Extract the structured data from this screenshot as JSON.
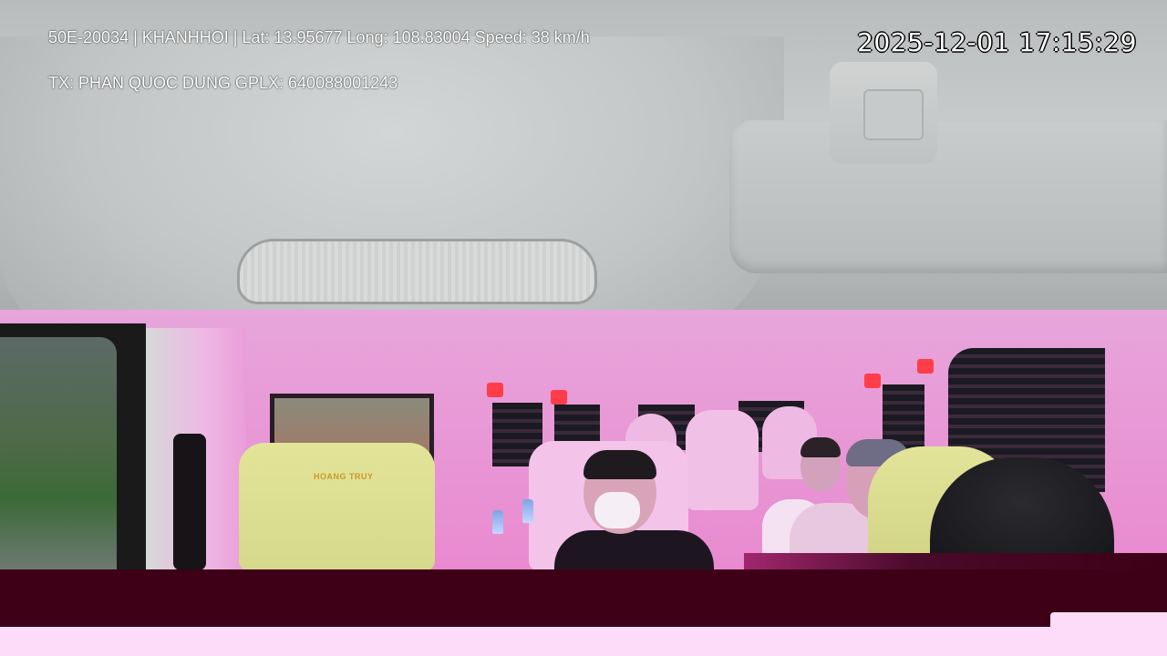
{
  "overlay": {
    "plate": "50E-20034",
    "operator": "KHANHHOI",
    "lat_label": "Lat:",
    "lat_value": "13.95677",
    "long_label": "Long:",
    "long_value": "108.83004",
    "speed_label": "Speed:",
    "speed_value": "38 km/h",
    "line1": "50E-20034 | KHANHHOI | Lat: 13.95677 Long: 108.83004 Speed: 38 km/h",
    "line2": "TX: PHAN QUOC DUNG GPLX: 640088001243",
    "timestamp": "2025-12-01 17:15:29"
  },
  "scene": {
    "seat_branding": "HOANG TRUY"
  },
  "colors": {
    "cabin_light": "#e98ad0",
    "ceiling": "#c3c6c6",
    "bottom_bar_dark": "#3d0016",
    "bottom_bar_light": "#fcdcf8",
    "overlay_text": "#ffffff",
    "seat_leather": "#dedc90"
  }
}
